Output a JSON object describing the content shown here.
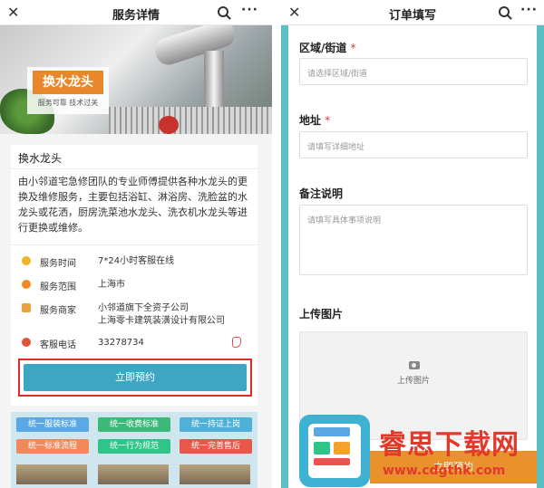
{
  "left": {
    "nav": {
      "title": "服务详情",
      "close": "✕",
      "more": "···"
    },
    "hero": {
      "badge_title": "换水龙头",
      "badge_sub": "服务可靠  技术过关"
    },
    "service": {
      "title": "换水龙头",
      "description": "由小邻道宅急修团队的专业师傅提供各种水龙头的更换及维修服务，主要包括浴缸、淋浴房、洗脸盆的水龙头或花洒，厨房洗菜池水龙头、洗衣机水龙头等进行更换或维修。",
      "rows": [
        {
          "label": "服务时间",
          "value": "7*24小时客服在线",
          "color": "#f0b429"
        },
        {
          "label": "服务范围",
          "value": "上海市",
          "color": "#f08a24"
        },
        {
          "label": "服务商家",
          "value": "小邻道旗下全资子公司",
          "value2": "上海零卡建筑装潢设计有限公司",
          "color": "#e8a040"
        },
        {
          "label": "客服电话",
          "value": "33278734",
          "color": "#e0533a"
        }
      ],
      "book_label": "立即预约"
    },
    "tags": [
      "统一服装标准",
      "统一收费标准",
      "统一持证上岗",
      "统一标准流程",
      "统一行为规范",
      "统一完善售后"
    ],
    "tag_colors": [
      "#5aa9e6",
      "#3cb878",
      "#4fb0d8",
      "#f08a5d",
      "#2fc488",
      "#e8574a"
    ]
  },
  "right": {
    "nav": {
      "title": "订单填写",
      "close": "✕",
      "more": "···"
    },
    "fields": {
      "district": {
        "label": "区域/街道",
        "placeholder": "请选择区域/街道"
      },
      "address": {
        "label": "地址",
        "placeholder": "请填写详细地址"
      },
      "note": {
        "label": "备注说明",
        "placeholder": "请填写具体事项说明"
      },
      "upload": {
        "label": "上传图片",
        "button": "上传图片"
      }
    },
    "bottom_button": "立即预约",
    "required_mark": "*"
  },
  "watermark": {
    "title": "睿思下载网",
    "url": "www.cdgthk.com"
  }
}
